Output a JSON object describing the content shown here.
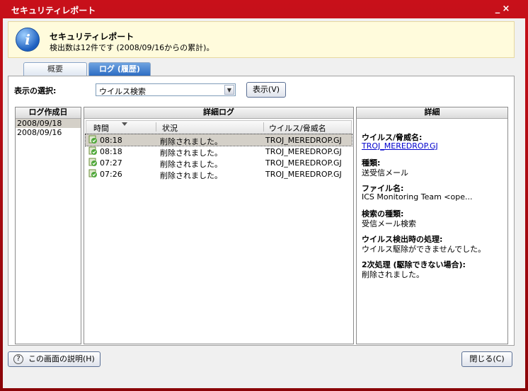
{
  "window": {
    "title": "セキュリティレポート",
    "minimize": "_",
    "close": "×"
  },
  "banner": {
    "title": "セキュリティレポート",
    "subtitle": "検出数は12件です (2008/09/16からの累計)。",
    "icon": "info-icon"
  },
  "tabs": [
    {
      "label": "概要",
      "active": false
    },
    {
      "label": "ログ (履歴)",
      "active": true
    }
  ],
  "filter": {
    "label": "表示の選択:",
    "selected": "ウイルス検索",
    "show_button": "表示(V)"
  },
  "dates": {
    "header": "ログ作成日",
    "items": [
      "2008/09/18",
      "2008/09/16"
    ],
    "selected_index": 0
  },
  "log": {
    "header": "詳細ログ",
    "columns": [
      "時間",
      "状況",
      "ウイルス/脅威名"
    ],
    "rows": [
      {
        "time": "08:18",
        "status": "削除されました。",
        "threat": "TROJ_MEREDROP.GJ",
        "selected": true
      },
      {
        "time": "08:18",
        "status": "削除されました。",
        "threat": "TROJ_MEREDROP.GJ"
      },
      {
        "time": "07:27",
        "status": "削除されました。",
        "threat": "TROJ_MEREDROP.GJ"
      },
      {
        "time": "07:26",
        "status": "削除されました。",
        "threat": "TROJ_MEREDROP.GJ"
      }
    ]
  },
  "detail": {
    "header": "詳細",
    "threat_label": "ウイルス/脅威名:",
    "threat_value": "TROJ_MEREDROP.GJ",
    "type_label": "種類:",
    "type_value": "送受信メール",
    "file_label": "ファイル名:",
    "file_value": "ICS Monitoring Team <ope...",
    "scan_label": "検索の種類:",
    "scan_value": "受信メール検索",
    "action_label": "ウイルス検出時の処理:",
    "action_value": "ウイルス駆除ができませんでした。",
    "secondary_label": "2次処理 (駆除できない場合):",
    "secondary_value": "削除されました。"
  },
  "footer": {
    "help_button": "この画面の説明(H)",
    "close_button": "閉じる(C)"
  }
}
